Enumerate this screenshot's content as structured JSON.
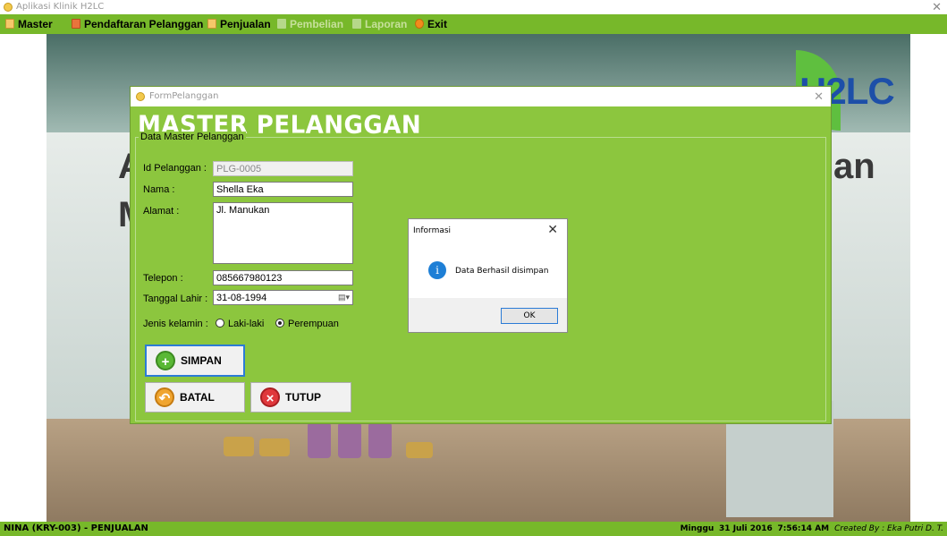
{
  "app": {
    "title": "Aplikasi Klinik H2LC"
  },
  "menu": [
    {
      "label": "Master",
      "enabled": true,
      "icon": "document-icon"
    },
    {
      "label": "Pendaftaran Pelanggan",
      "enabled": true,
      "icon": "user-card-icon"
    },
    {
      "label": "Penjualan",
      "enabled": true,
      "icon": "document-icon"
    },
    {
      "label": "Pembelian",
      "enabled": false,
      "icon": "document-icon"
    },
    {
      "label": "Laporan",
      "enabled": false,
      "icon": "printer-icon"
    },
    {
      "label": "Exit",
      "enabled": true,
      "icon": "power-icon"
    }
  ],
  "background": {
    "logo_text": "H2LC",
    "partial_text_1": "A",
    "partial_text_2": "M",
    "partial_text_3": "an"
  },
  "form": {
    "window_title": "FormPelanggan",
    "heading": "MASTER PELANGGAN",
    "group_label": "Data Master Pelanggan",
    "id_label": "Id Pelanggan :",
    "id_value": "PLG-0005",
    "nama_label": "Nama :",
    "nama_value": "Shella Eka",
    "alamat_label": "Alamat :",
    "alamat_value": "Jl. Manukan",
    "telepon_label": "Telepon :",
    "telepon_value": "085667980123",
    "tgl_label": "Tanggal Lahir :",
    "tgl_value": "31-08-1994",
    "jk_label": "Jenis kelamin :",
    "jk_options": [
      "Laki-laki",
      "Perempuan"
    ],
    "jk_selected": "Perempuan",
    "simpan_label": "SIMPAN",
    "batal_label": "BATAL",
    "tutup_label": "TUTUP"
  },
  "messagebox": {
    "title": "Informasi",
    "text": "Data Berhasil disimpan",
    "ok_label": "OK",
    "icon": "info-icon"
  },
  "status": {
    "user": "NINA (KRY-003) - PENJUALAN",
    "day": "Minggu",
    "date": "31 Juli 2016",
    "time": "7:56:14 AM",
    "credit": "Created By : Eka Putri D. T."
  },
  "colors": {
    "accent": "#8cc63e",
    "menubar": "#77b82a",
    "ok_border": "#2b7bd6"
  }
}
